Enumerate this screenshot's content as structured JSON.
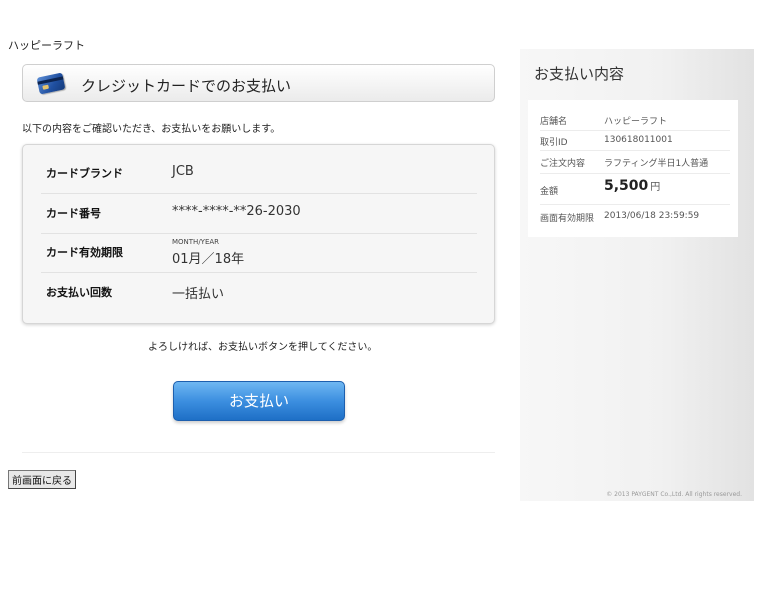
{
  "shop_name": "ハッピーラフト",
  "header": {
    "title": "クレジットカードでのお支払い",
    "icon": "credit-card-icon"
  },
  "intro_text": "以下の内容をご確認いただき、お支払いをお願いします。",
  "details": {
    "brand_label": "カードブランド",
    "brand_value": "JCB",
    "number_label": "カード番号",
    "number_value": "****-****-**26-2030",
    "expiry_label": "カード有効期限",
    "expiry_note": "MONTH/YEAR",
    "expiry_value": "01月／18年",
    "installments_label": "お支払い回数",
    "installments_value": "一括払い"
  },
  "confirm_text": "よろしければ、お支払いボタンを押してください。",
  "pay_button": "お支払い",
  "back_button": "前画面に戻る",
  "sidebar": {
    "title": "お支払い内容",
    "shop_label": "店舗名",
    "shop_value": "ハッピーラフト",
    "txn_label": "取引ID",
    "txn_value": "130618011001",
    "order_label": "ご注文内容",
    "order_value": "ラフティング半日1人普通",
    "amount_label": "金額",
    "amount_value": "5,500",
    "amount_unit": "円",
    "expiry_label": "画面有効期限",
    "expiry_value": "2013/06/18 23:59:59",
    "copyright": "© 2013 PAYGENT Co.,Ltd. All rights reserved."
  },
  "colors": {
    "pay_button": "#3c8fe0",
    "card_icon": "#1f4fa0"
  }
}
